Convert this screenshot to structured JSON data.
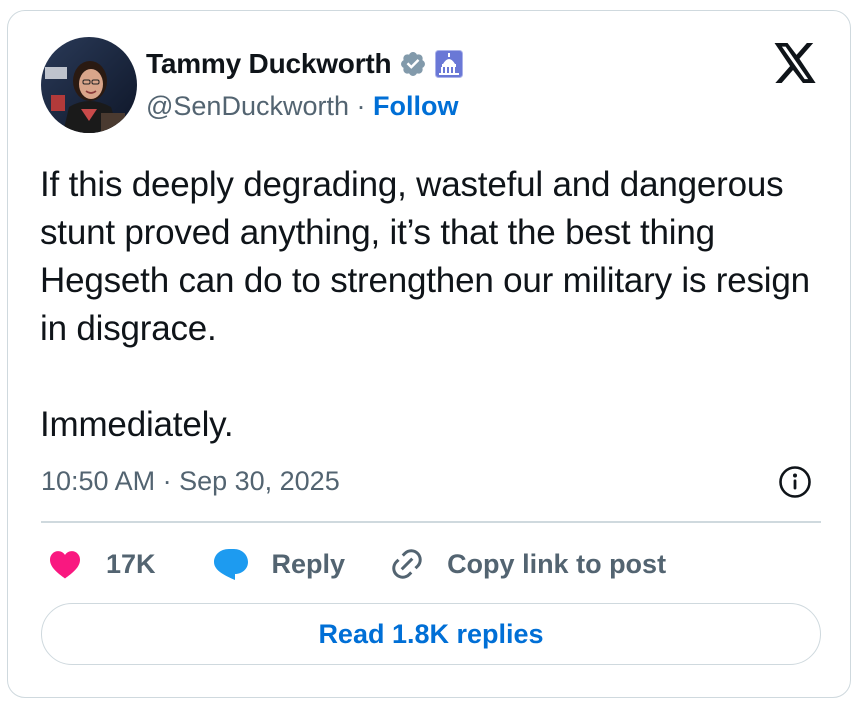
{
  "author": {
    "display_name": "Tammy Duckworth",
    "handle": "@SenDuckworth",
    "separator": " · ",
    "follow_label": "Follow",
    "verified_badge_icon": "verified-badge-icon",
    "government_badge_icon": "capitol-badge-icon",
    "avatar_icon": "avatar-photo"
  },
  "brand": {
    "logo_icon": "x-logo-icon"
  },
  "tweet": {
    "lines": [
      "If this deeply degrading, wasteful and dangerous stunt proved anything, it’s that the best thing Hegseth can do to strengthen our military is resign in disgrace.",
      "Immediately."
    ],
    "timestamp": "10:50 AM · Sep 30, 2025"
  },
  "actions": {
    "like_count": "17K",
    "reply_label": "Reply",
    "copy_link_label": "Copy link to post",
    "read_replies_label": "Read 1.8K replies"
  },
  "colors": {
    "text_primary": "#0f1419",
    "text_secondary": "#536471",
    "link_blue": "#006fd6",
    "heart_pink": "#f91880",
    "reply_blue": "#1d9bf0",
    "border": "#cfd9de"
  }
}
